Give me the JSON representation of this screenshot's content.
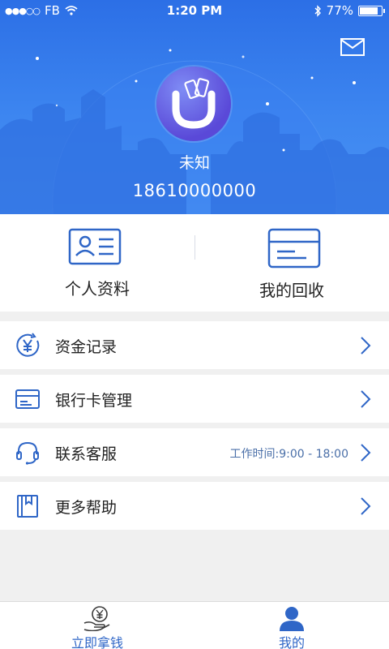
{
  "status_bar": {
    "carrier": "FB",
    "time": "1:20 PM",
    "battery": "77%",
    "icons": [
      "signal-dots-icon",
      "wifi-icon",
      "bluetooth-icon",
      "battery-icon"
    ]
  },
  "header": {
    "mail_icon": "mail-icon",
    "avatar_icon": "app-logo-icon",
    "username": "未知",
    "phone": "18610000000"
  },
  "quick_actions": [
    {
      "label": "个人资料",
      "icon": "id-card-icon"
    },
    {
      "label": "我的回收",
      "icon": "card-icon"
    }
  ],
  "menu": [
    {
      "label": "资金记录",
      "icon": "yuan-icon",
      "extra": ""
    },
    {
      "label": "银行卡管理",
      "icon": "bank-card-icon",
      "extra": ""
    },
    {
      "label": "联系客服",
      "icon": "headset-icon",
      "extra": "工作时间:9:00 - 18:00"
    },
    {
      "label": "更多帮助",
      "icon": "book-icon",
      "extra": ""
    }
  ],
  "tabbar": [
    {
      "label": "立即拿钱",
      "icon": "money-icon",
      "active": false
    },
    {
      "label": "我的",
      "icon": "person-icon",
      "active": true
    }
  ],
  "colors": {
    "header_blue": "#2c6fe6",
    "accent_blue": "#2f66c7",
    "avatar_purple": "#5a49d8"
  }
}
